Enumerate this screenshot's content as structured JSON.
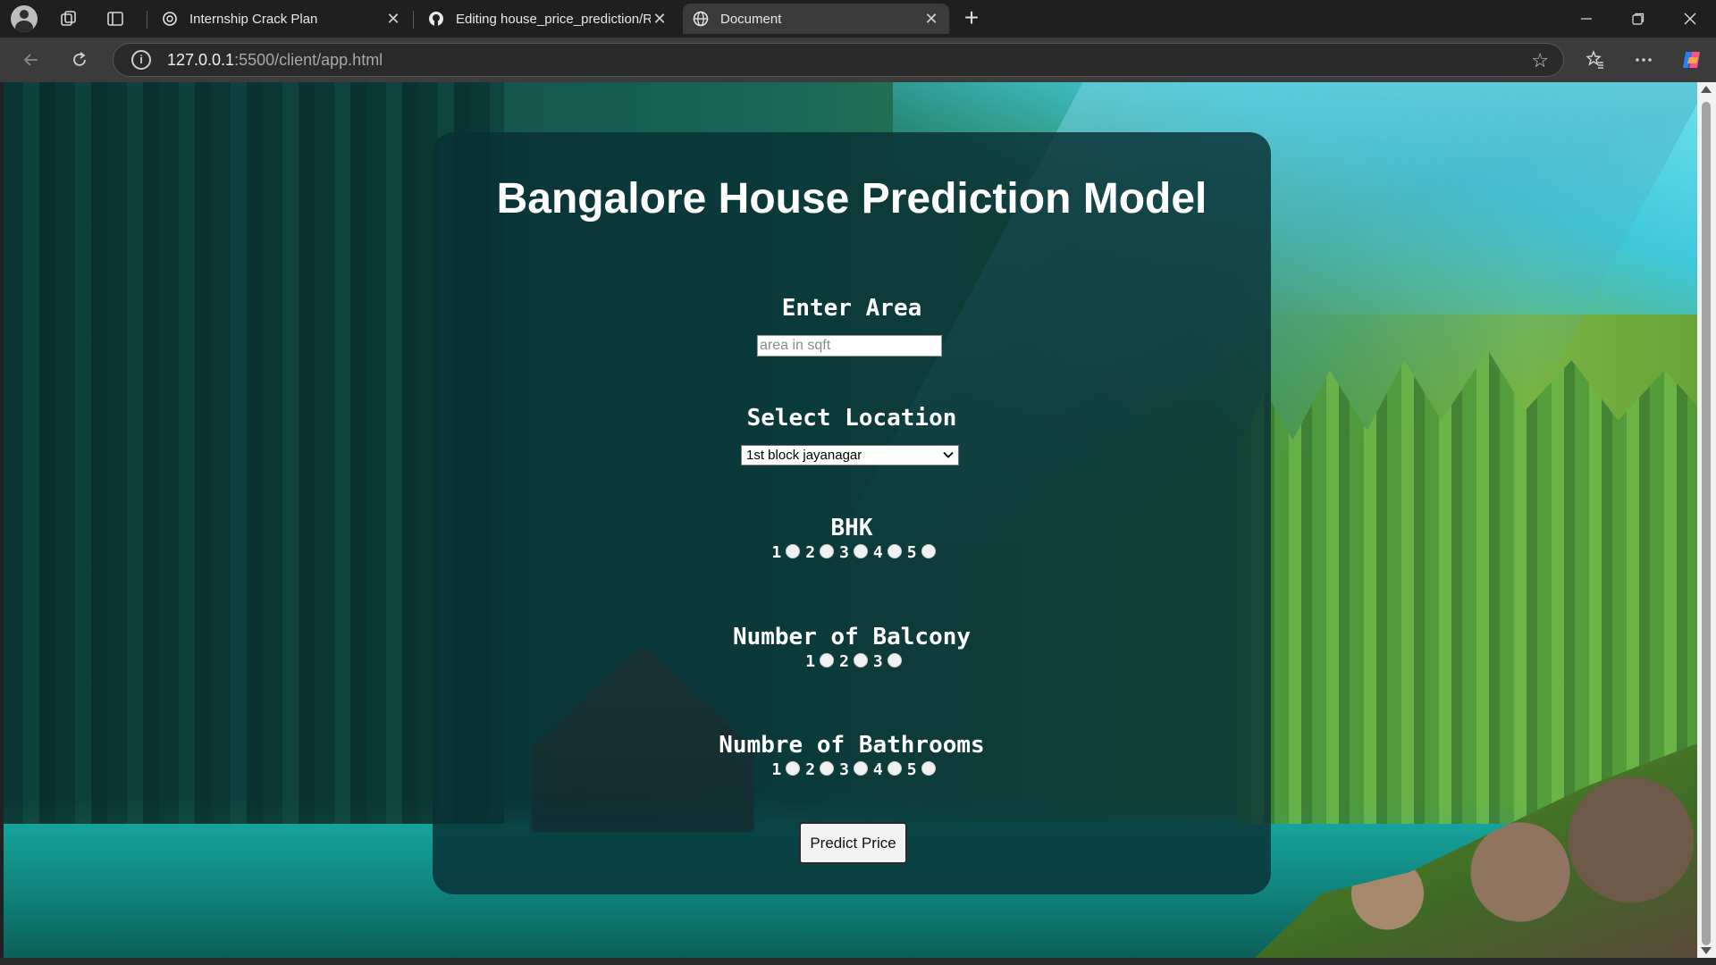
{
  "browser": {
    "tabs": [
      {
        "title": "Internship Crack Plan",
        "icon": "openai-icon",
        "active": false
      },
      {
        "title": "Editing house_price_prediction/RE",
        "icon": "github-icon",
        "active": false
      },
      {
        "title": "Document",
        "icon": "globe-icon",
        "active": true
      }
    ],
    "new_tab": "+",
    "url_host": "127.0.0.1",
    "url_path": ":5500/client/app.html"
  },
  "page": {
    "title": "Bangalore House Prediction Model",
    "area": {
      "label": "Enter Area",
      "placeholder": "area in sqft",
      "value": ""
    },
    "location": {
      "label": "Select Location",
      "selected": "1st block jayanagar"
    },
    "bhk": {
      "label": "BHK",
      "options": [
        "1",
        "2",
        "3",
        "4",
        "5"
      ]
    },
    "balcony": {
      "label": "Number of Balcony",
      "options": [
        "1",
        "2",
        "3"
      ]
    },
    "bathrooms": {
      "label": "Numbre of Bathrooms",
      "options": [
        "1",
        "2",
        "3",
        "4",
        "5"
      ]
    },
    "predict_button": "Predict Price"
  },
  "colors": {
    "card_bg": "#08303499",
    "tab_active": "#3b3b3b",
    "toolbar": "#3b3b3b"
  }
}
